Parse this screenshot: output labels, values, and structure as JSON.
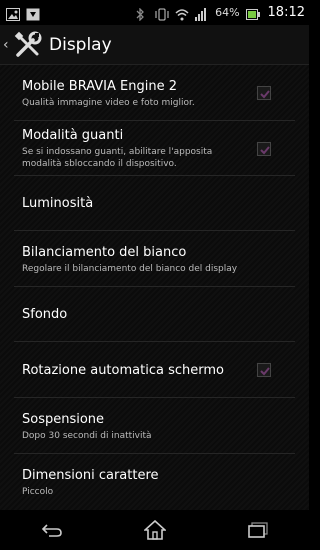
{
  "status_bar": {
    "icons_left": [
      "image-icon",
      "download-icon"
    ],
    "icons_right": [
      "bluetooth-icon",
      "vibrate-icon",
      "wifi-icon",
      "signal-icon",
      "battery-icon"
    ],
    "battery_percent": "64%",
    "time": "18:12"
  },
  "action_bar": {
    "title": "Display",
    "icon": "settings-tools-icon"
  },
  "settings": [
    {
      "title": "Mobile BRAVIA Engine 2",
      "subtitle": "Qualità immagine video e foto miglior.",
      "checkbox": true,
      "checked": false
    },
    {
      "title": "Modalità guanti",
      "subtitle": "Se si indossano guanti, abilitare l'apposita modalità sbloccando il dispositivo.",
      "checkbox": true,
      "checked": false
    },
    {
      "title": "Luminosità",
      "subtitle": "",
      "checkbox": false
    },
    {
      "title": "Bilanciamento del bianco",
      "subtitle": "Regolare il bilanciamento del bianco del display",
      "checkbox": false
    },
    {
      "title": "Sfondo",
      "subtitle": "",
      "checkbox": false
    },
    {
      "title": "Rotazione automatica schermo",
      "subtitle": "",
      "checkbox": true,
      "checked": false
    },
    {
      "title": "Sospensione",
      "subtitle": "Dopo 30 secondi di inattività",
      "checkbox": false
    },
    {
      "title": "Dimensioni carattere",
      "subtitle": "Piccolo",
      "checkbox": false
    }
  ],
  "nav_bar": {
    "buttons": [
      "back-icon",
      "home-icon",
      "recent-apps-icon"
    ]
  },
  "colors": {
    "checkbox_tint": "#6a3a6a",
    "battery_green": "#7ac943"
  }
}
